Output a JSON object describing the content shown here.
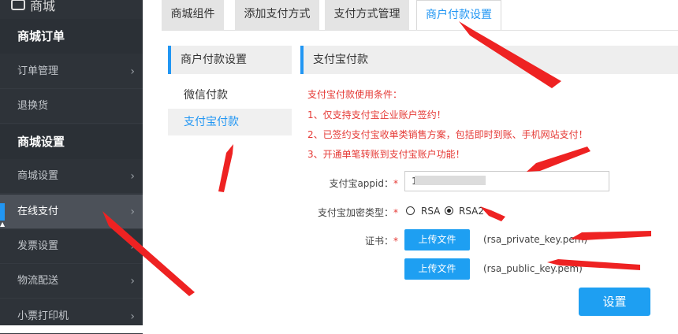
{
  "sidebar": {
    "logo_label": "商城",
    "section_orders": "商城订单",
    "order_items": [
      "订单管理",
      "退换货"
    ],
    "section_settings": "商城设置",
    "settings_items": [
      "商城设置",
      "在线支付",
      "发票设置",
      "物流配送",
      "小票打印机"
    ],
    "active_item": "在线支付",
    "chevron": "›"
  },
  "tabs": [
    "商城组件",
    "添加支付方式",
    "支付方式管理",
    "商户付款设置"
  ],
  "active_tab": "商户付款设置",
  "submenu": {
    "title": "商户付款设置",
    "items": [
      "微信付款",
      "支付宝付款"
    ],
    "selected": "支付宝付款"
  },
  "panel": {
    "title": "支付宝付款",
    "conditions": [
      "支付宝付款使用条件：",
      "1、仅支持支付宝企业账户签约！",
      "2、已签约支付宝收单类销售方案，包括即时到账、手机网站支付！",
      "3、开通单笔转账到支付宝账户功能！"
    ],
    "appid_label": "支付宝appid",
    "appid_value": "1",
    "encrypt_label": "支付宝加密类型",
    "encrypt_options": [
      "RSA",
      "RSA2"
    ],
    "encrypt_selected": "RSA2",
    "cert_label": "证书",
    "upload_label": "上传文件",
    "private_key_file": "(rsa_private_key.pem)",
    "public_key_file": "(rsa_public_key.pem)",
    "save_label": "设置",
    "required_mark": "*",
    "colon": "："
  },
  "colors": {
    "accent": "#1e9ff2",
    "warning": "#e53935",
    "sidebar_bg": "#2e3339"
  }
}
